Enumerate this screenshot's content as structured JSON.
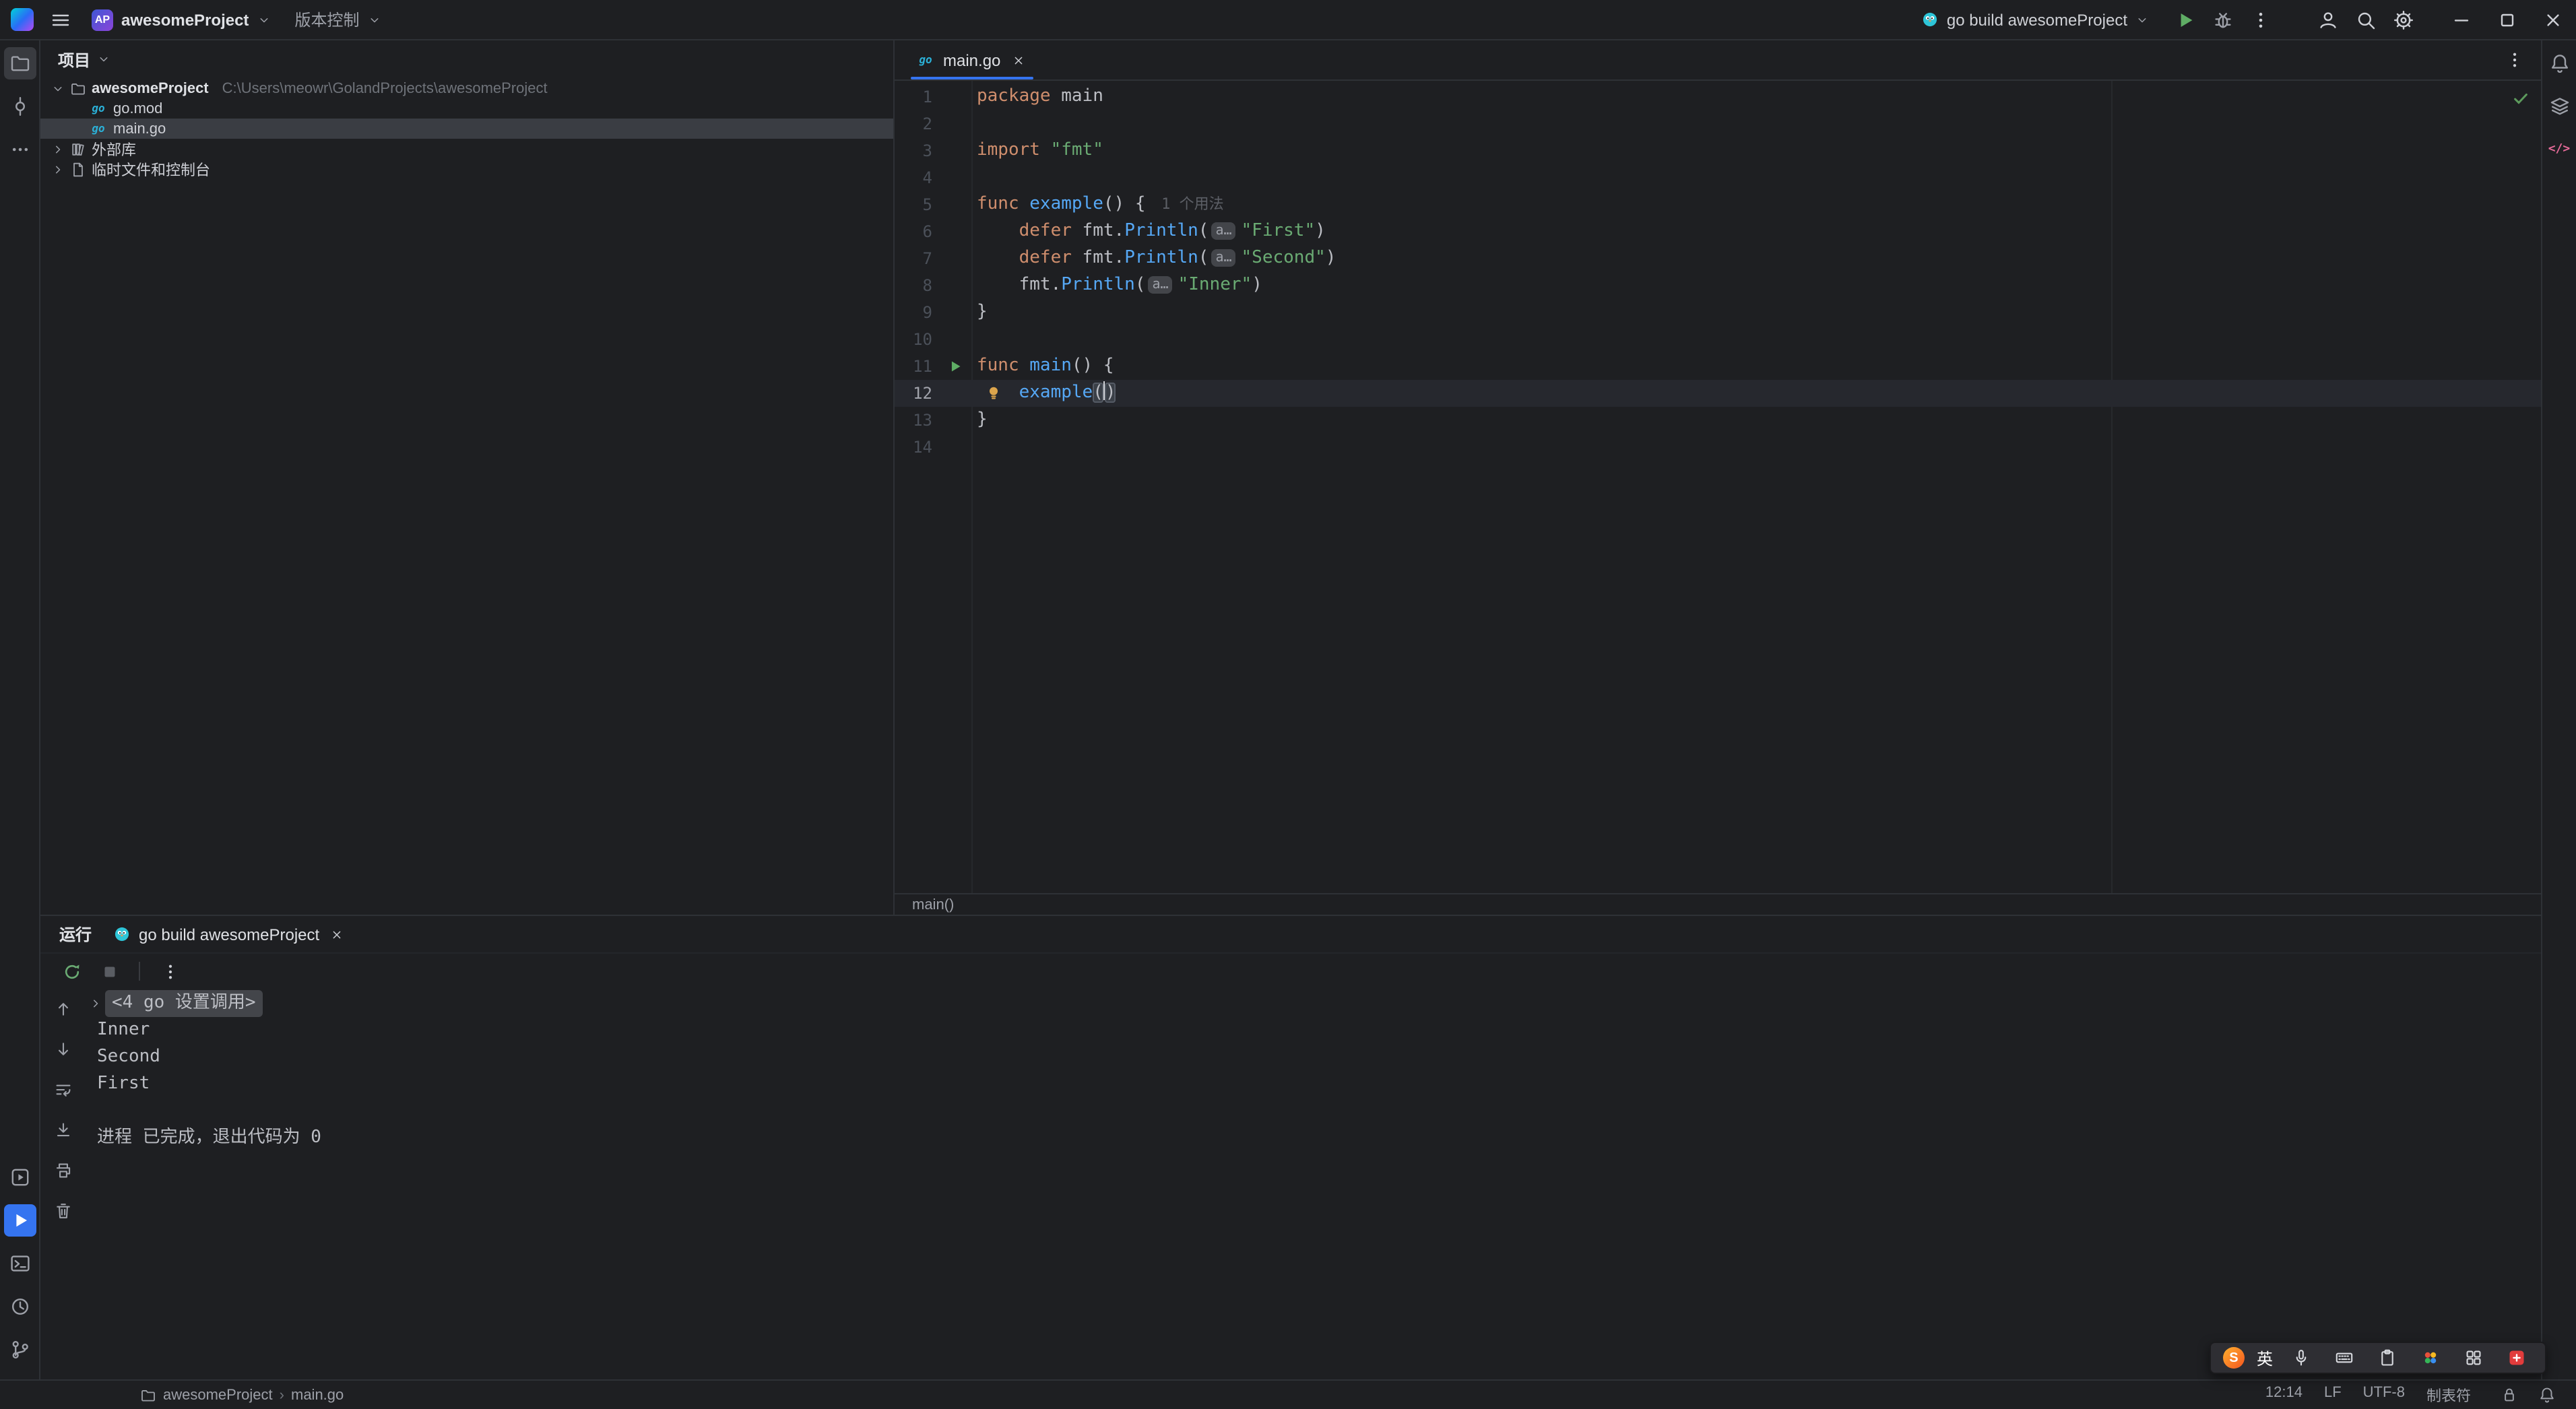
{
  "titlebar": {
    "project_badge": "AP",
    "project_name": "awesomeProject",
    "vcs_label": "版本控制",
    "run_config_label": "go build awesomeProject",
    "action_icons": [
      "run-icon",
      "debug-icon",
      "more-vertical-icon"
    ],
    "account_icons": [
      "user-icon",
      "search-icon",
      "settings-icon"
    ],
    "window_icons": [
      "minimize-icon",
      "maximize-icon",
      "close-icon"
    ]
  },
  "left_stripe": {
    "top": [
      "project-folder-icon",
      "commit-icon",
      "more-horizontal-icon"
    ],
    "bottom": [
      "services-icon",
      "run-tool-icon",
      "terminal-icon",
      "history-icon",
      "git-branch-icon"
    ],
    "active": "run-tool-icon",
    "open": "project-folder-icon"
  },
  "right_stripe": {
    "icons": [
      "notifications-icon",
      "layers-icon",
      "ai-code-icon"
    ]
  },
  "project_panel": {
    "title": "项目",
    "items": [
      {
        "icon": "project-folder-icon",
        "label": "awesomeProject",
        "path": "C:\\Users\\meowr\\GolandProjects\\awesomeProject",
        "level": 0,
        "chevron": "down",
        "bold": true
      },
      {
        "icon": "go-file-icon",
        "label": "go.mod",
        "level": 1
      },
      {
        "icon": "go-file-icon",
        "label": "main.go",
        "level": 1,
        "selected": true
      },
      {
        "icon": "library-icon",
        "label": "外部库",
        "level": 0,
        "chevron": "right"
      },
      {
        "icon": "scratch-icon",
        "label": "临时文件和控制台",
        "level": 0,
        "chevron": "right"
      }
    ]
  },
  "editor": {
    "tab_label": "main.go",
    "breadcrumb": "main()",
    "lines": [
      {
        "n": 1,
        "tokens": [
          [
            "kw",
            "package"
          ],
          [
            "t",
            " main"
          ]
        ]
      },
      {
        "n": 2,
        "tokens": []
      },
      {
        "n": 3,
        "tokens": [
          [
            "kw",
            "import"
          ],
          [
            "s",
            " \"fmt\""
          ]
        ]
      },
      {
        "n": 4,
        "tokens": []
      },
      {
        "n": 5,
        "tokens": [
          [
            "kw",
            "func"
          ],
          [
            "fn",
            " example"
          ],
          [
            "t",
            "() { "
          ],
          [
            "u",
            "1 个用法"
          ]
        ]
      },
      {
        "n": 6,
        "tokens": [
          [
            "t",
            "    "
          ],
          [
            "kw",
            "defer"
          ],
          [
            "t",
            " fmt."
          ],
          [
            "fn",
            "Println"
          ],
          [
            "t",
            "("
          ],
          [
            "h",
            "a…"
          ],
          [
            "s",
            "\"First\""
          ],
          [
            "t",
            ")"
          ]
        ]
      },
      {
        "n": 7,
        "tokens": [
          [
            "t",
            "    "
          ],
          [
            "kw",
            "defer"
          ],
          [
            "t",
            " fmt."
          ],
          [
            "fn",
            "Println"
          ],
          [
            "t",
            "("
          ],
          [
            "h",
            "a…"
          ],
          [
            "s",
            "\"Second\""
          ],
          [
            "t",
            ")"
          ]
        ]
      },
      {
        "n": 8,
        "tokens": [
          [
            "t",
            "    fmt."
          ],
          [
            "fn",
            "Println"
          ],
          [
            "t",
            "("
          ],
          [
            "h",
            "a…"
          ],
          [
            "s",
            "\"Inner\""
          ],
          [
            "t",
            ")"
          ]
        ]
      },
      {
        "n": 9,
        "tokens": [
          [
            "t",
            "}"
          ]
        ]
      },
      {
        "n": 10,
        "tokens": []
      },
      {
        "n": 11,
        "run": true,
        "tokens": [
          [
            "kw",
            "func"
          ],
          [
            "fn",
            " main"
          ],
          [
            "t",
            "() {"
          ]
        ]
      },
      {
        "n": 12,
        "current": true,
        "bulb": true,
        "tokens": [
          [
            "t",
            "    "
          ],
          [
            "fn",
            "example"
          ],
          [
            "b",
            "("
          ],
          [
            "caret",
            ""
          ],
          [
            "b",
            ")"
          ]
        ]
      },
      {
        "n": 13,
        "tokens": [
          [
            "t",
            "}"
          ]
        ]
      },
      {
        "n": 14,
        "tokens": []
      }
    ]
  },
  "run_panel": {
    "title": "运行",
    "tab_label": "go build awesomeProject",
    "toolbar_icons": [
      "rerun-icon",
      "stop-icon"
    ],
    "more_icons": [
      "more-vertical-icon"
    ],
    "side_icons": [
      "up-icon",
      "down-icon",
      "soft-wrap-icon",
      "scroll-end-icon",
      "print-icon",
      "clear-icon"
    ],
    "console": [
      {
        "type": "fold",
        "text": "<4 go 设置调用>"
      },
      {
        "type": "out",
        "text": "Inner"
      },
      {
        "type": "out",
        "text": "Second"
      },
      {
        "type": "out",
        "text": "First"
      },
      {
        "type": "blank",
        "text": ""
      },
      {
        "type": "out",
        "text": "进程 已完成，退出代码为 0"
      }
    ]
  },
  "statusbar": {
    "project": "awesomeProject",
    "file": "main.go",
    "items": [
      {
        "name": "cursor-position",
        "text": "12:14"
      },
      {
        "name": "line-separator",
        "text": "LF"
      },
      {
        "name": "file-encoding",
        "text": "UTF-8"
      },
      {
        "name": "indent-style",
        "text": "制表符"
      }
    ],
    "icons": [
      "lock-icon",
      "notifications-icon"
    ]
  },
  "ime": {
    "badge": "S",
    "lang": "英",
    "icons": [
      "mic-icon",
      "keyboard-icon",
      "clipboard-icon",
      "pinwheel-icon",
      "grid-icon",
      "toolbox-icon"
    ]
  }
}
